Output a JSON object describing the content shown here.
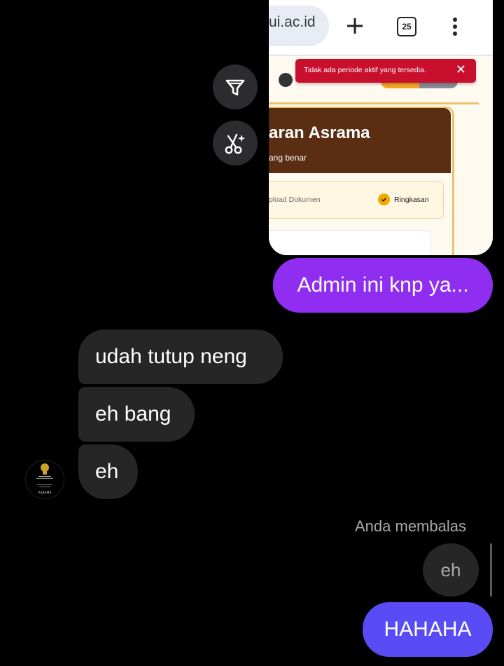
{
  "shared_screenshot": {
    "url_fragment": "ui.ac.id",
    "tab_count": "25",
    "toast_message": "Tidak ada periode aktif yang tersedia.",
    "page_heading": "aran Asrama",
    "page_subheading": "ang benar",
    "step_upload": "pload Dokumen",
    "step_summary": "Ringkasan"
  },
  "messages": {
    "sent_1": "Admin ini knp ya...",
    "received": [
      "udah tutup neng",
      "eh bang",
      "eh"
    ],
    "reply_label": "Anda membalas",
    "replied_to": "eh",
    "sent_2": "HAHAHA"
  },
  "avatar": {
    "caption": "ASRAMA"
  },
  "colors": {
    "background": "#000000",
    "received_bubble": "#262626",
    "sent_bubble_purple": "#8f2df0",
    "sent_bubble_indigo": "#5a4cf5",
    "toast_red": "#c8102e",
    "page_brown": "#5b2d12"
  },
  "icons": {
    "filter_action": "filter-funnel-icon",
    "ai_edit_action": "scissors-sparkle-icon",
    "new_tab": "plus-icon",
    "tab_switcher": "tab-count-icon",
    "menu": "more-vert-icon",
    "toast_close": "close-icon",
    "step_check": "check-circle-icon"
  }
}
